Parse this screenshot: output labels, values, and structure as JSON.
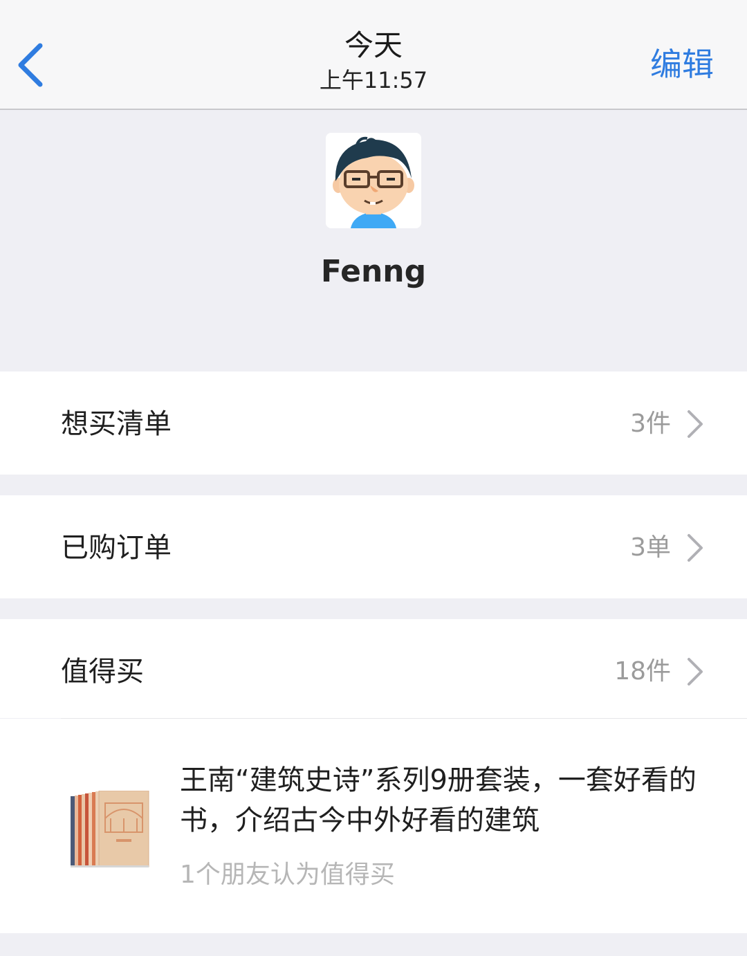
{
  "nav": {
    "title": "今天",
    "subtitle": "上午11:57",
    "edit_label": "编辑",
    "back_icon": "chevron-left-icon",
    "accent_color": "#2f7ce0"
  },
  "profile": {
    "username": "Fenng",
    "avatar_icon": "cartoon-avatar-glasses"
  },
  "rows": {
    "wishlist": {
      "label": "想买清单",
      "value": "3件"
    },
    "orders": {
      "label": "已购订单",
      "value": "3单"
    },
    "worth_buying": {
      "label": "值得买",
      "value": "18件"
    }
  },
  "product": {
    "title": "王南“建筑史诗”系列9册套装，一套好看的书，介绍古今中外好看的建筑",
    "meta": "1个朋友认为值得买",
    "thumb_icon": "book-set-thumbnail"
  }
}
